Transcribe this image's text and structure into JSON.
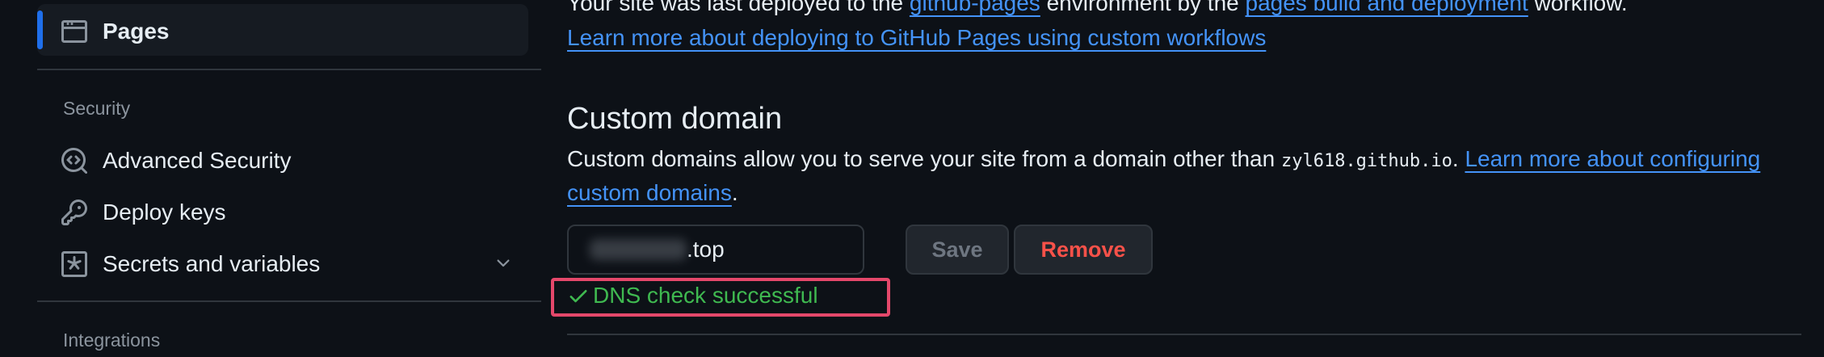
{
  "sidebar": {
    "pages": {
      "label": "Pages",
      "icon": "browser-icon"
    },
    "security_heading": "Security",
    "advanced_security": {
      "label": "Advanced Security",
      "icon": "codescan-icon"
    },
    "deploy_keys": {
      "label": "Deploy keys",
      "icon": "key-icon"
    },
    "secrets_variables": {
      "label": "Secrets and variables",
      "icon": "asterisk-box-icon",
      "expand_icon": "chevron-down-icon"
    },
    "integrations_heading": "Integrations"
  },
  "deploy": {
    "line1_a": "Your site was last deployed to the ",
    "line1_link1": "github-pages",
    "line1_b": " environment by the ",
    "line1_link2": "pages build and deployment",
    "line1_c": " workflow.",
    "learn_more": "Learn more about deploying to GitHub Pages using custom workflows"
  },
  "custom_domain": {
    "title": "Custom domain",
    "desc_a": "Custom domains allow you to serve your site from a domain other than ",
    "desc_code": "zyl618.github.io",
    "desc_b": ". ",
    "link_part1": "Learn more about configuring",
    "link_part2": "custom domains",
    "desc_end": ".",
    "input_value_visible": ".top",
    "save_label": "Save",
    "remove_label": "Remove",
    "dns_status": "DNS check successful",
    "dns_icon": "check-icon"
  },
  "colors": {
    "background": "#0d1117",
    "link": "#4493f8",
    "success": "#3fb950",
    "danger": "#f85149",
    "highlight": "#e5486b",
    "active_indicator": "#1f6feb"
  }
}
